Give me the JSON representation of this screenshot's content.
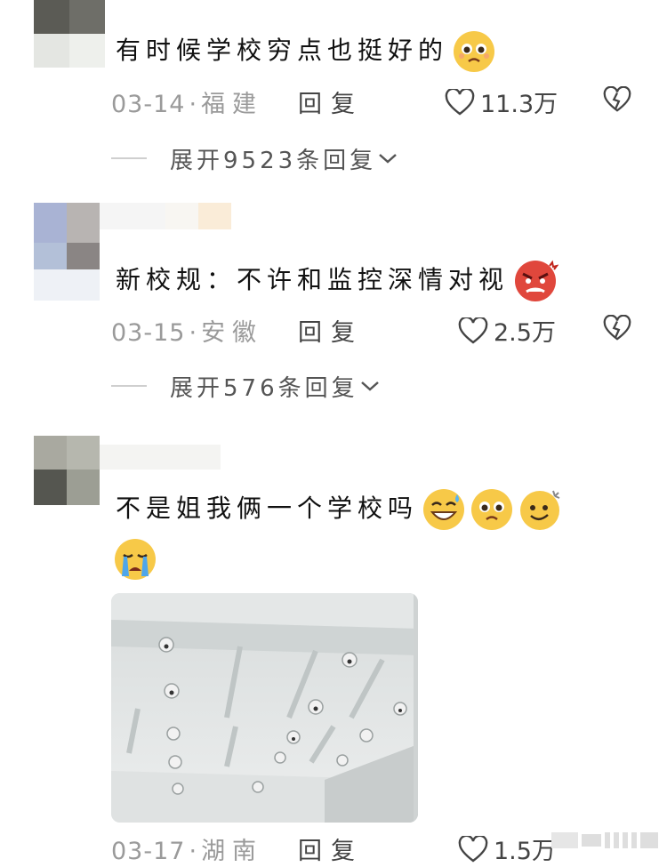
{
  "comments": [
    {
      "text": "有时候学校穷点也挺好的",
      "emojis": [
        "pleading-face"
      ],
      "date": "03-14",
      "location": "福建",
      "reply_label": "回复",
      "likes": "11.3万",
      "expand": "展开9523条回复"
    },
    {
      "text": "新校规：不许和监控深情对视",
      "emojis": [
        "angry-face"
      ],
      "date": "03-15",
      "location": "安徽",
      "reply_label": "回复",
      "likes": "2.5万",
      "expand": "展开576条回复"
    },
    {
      "text": "不是姐我俩一个学校吗",
      "emojis": [
        "sweat-grin-face",
        "pleading-face",
        "dizzy-smile-face",
        "crying-face"
      ],
      "date": "03-17",
      "location": "湖南",
      "reply_label": "回复",
      "likes": "1.5万",
      "image": "photo of ceiling with many security cameras"
    }
  ],
  "separator": "·",
  "colors": {
    "meta_gray": "#9a9a9a",
    "text": "#111111",
    "emoji_yellow": "#f7c948"
  }
}
